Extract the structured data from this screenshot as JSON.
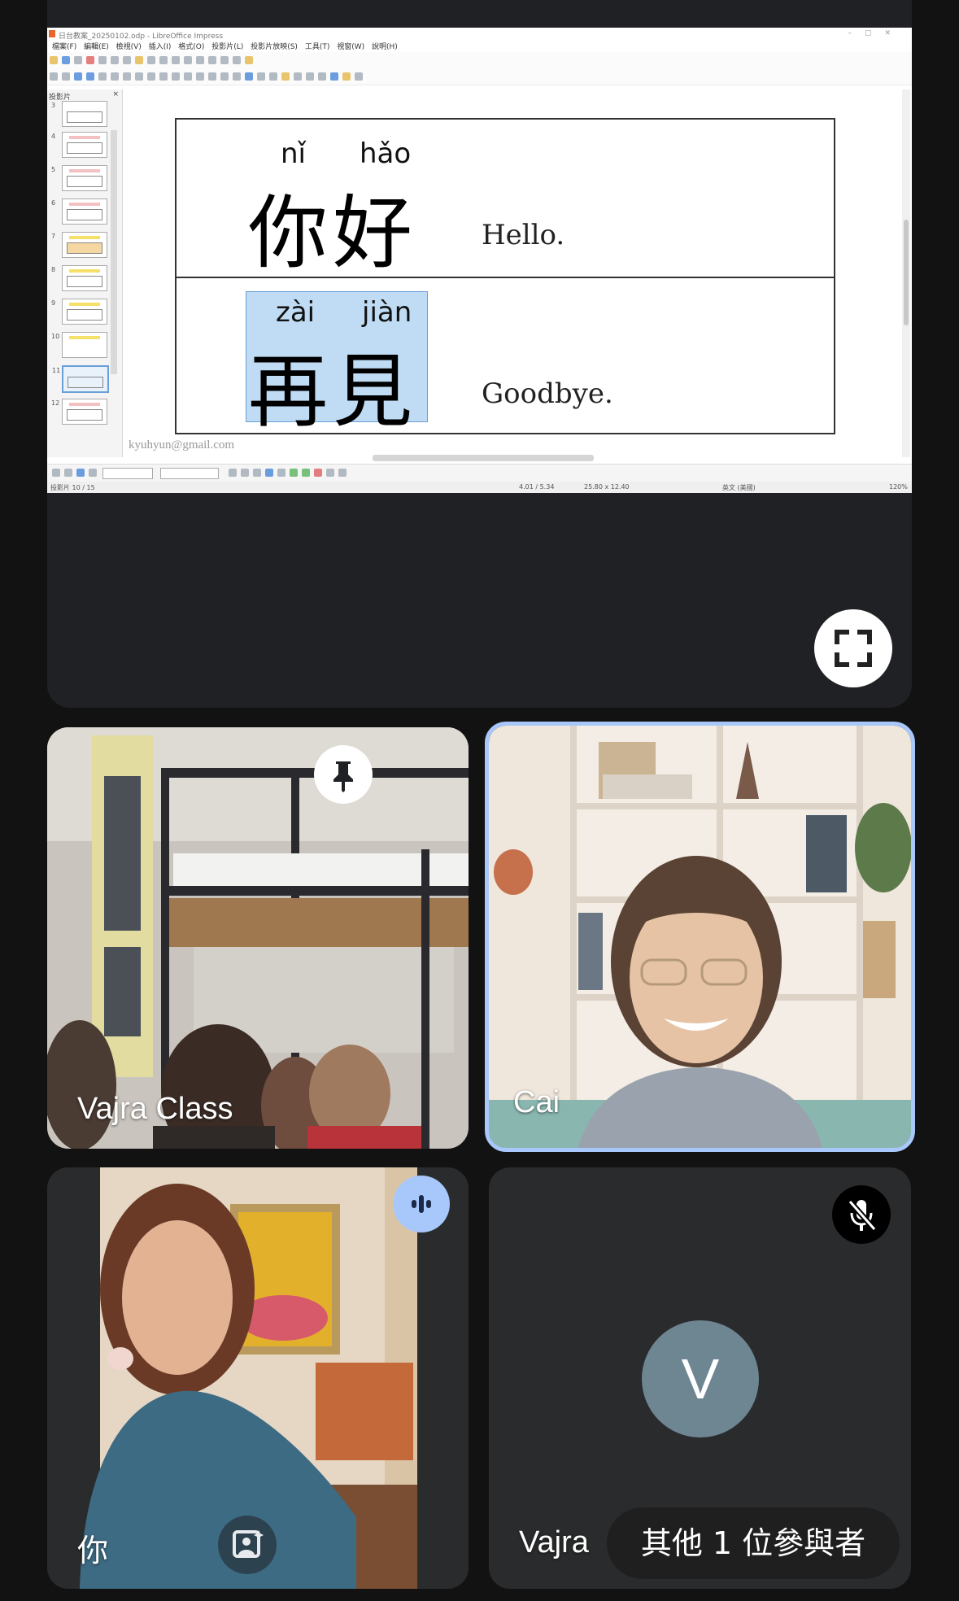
{
  "share": {
    "window_title": "日台教案_20250102.odp - LibreOffice Impress",
    "menu_items": [
      "檔案(F)",
      "編輯(E)",
      "檢視(V)",
      "插入(I)",
      "格式(O)",
      "投影片(L)",
      "投影片放映(S)",
      "工具(T)",
      "視窗(W)",
      "說明(H)"
    ],
    "slide_pane_title": "投影片",
    "slide_pane_close": "×",
    "thumb_numbers": [
      "3",
      "4",
      "5",
      "6",
      "7",
      "8",
      "9",
      "10",
      "11",
      "12"
    ],
    "row1": {
      "pinyin_1": "nǐ",
      "pinyin_2": "hǎo",
      "hanzi": "你好",
      "english": "Hello."
    },
    "row2": {
      "pinyin_1": "zài",
      "pinyin_2": "jiàn",
      "hanzi": "再見",
      "english": "Goodbye."
    },
    "email": "kyuhyun@gmail.com",
    "status_slide": "投影片 10 / 15",
    "status_position": "4.01 / 5.34",
    "status_size": "25.80 x 12.40",
    "status_lang": "英文 (美國)",
    "status_zoom": "120%"
  },
  "participants": {
    "vajra_class_name": "Vajra Class",
    "cai_name": "Cai",
    "you_name": "你",
    "vajra_name": "Vajra",
    "vajra_avatar_letter": "V",
    "others_label": "其他 1 位參與者"
  },
  "colors": {
    "background": "#121212",
    "tile": "#2a2b2c",
    "active_speaker_border": "#a8c7fa",
    "speaking_badge": "#a8c7fa",
    "avatar": "#6e8592"
  }
}
